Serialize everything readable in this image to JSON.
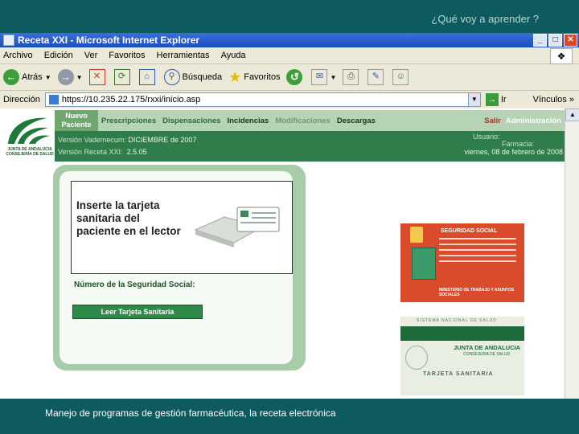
{
  "slide": {
    "title": "¿Qué voy a aprender ?",
    "footer": "Manejo de programas de gestión farmacéutica,  la receta electrónica"
  },
  "window": {
    "title": "Receta XXI - Microsoft Internet Explorer",
    "buttons": {
      "minimize": "_",
      "maximize": "□",
      "close": "✕"
    }
  },
  "menu": [
    "Archivo",
    "Edición",
    "Ver",
    "Favoritos",
    "Herramientas",
    "Ayuda"
  ],
  "toolbar": {
    "back": "Atrás",
    "search": "Búsqueda",
    "favorites": "Favoritos"
  },
  "address": {
    "label": "Dirección",
    "url": "https://10.235.22.175/rxxi/inicio.asp",
    "go": "Ir",
    "links": "Vínculos"
  },
  "app": {
    "logo_text": "JUNTA DE ANDALUCIA\nCONSEJERÍA DE SALUD",
    "nav": {
      "nuevo_paciente": "Nuevo Paciente",
      "prescripciones": "Prescripciones",
      "dispensaciones": "Dispensaciones",
      "incidencias": "Incidencias",
      "modificaciones": "Modificaciones",
      "descargas": "Descargas",
      "salir": "Salir",
      "administracion": "Administración"
    },
    "info": {
      "vademecum_label": "Versión Vademecum:",
      "vademecum_value": "DICIEMBRE de 2007",
      "receta_label": "Versión Receta XXI:",
      "receta_value": "2.5.05",
      "usuario_label": "Usuario:",
      "farmacia_label": "Farmacia:",
      "date": "viernes, 08 de febrero de 2008"
    },
    "panel": {
      "instruction": "Inserte la tarjeta sanitaria del paciente en el lector",
      "nss_label": "Número de la Seguridad Social:",
      "read_button": "Leer Tarjeta Sanitaria"
    },
    "ss_card": {
      "header": "SEGURIDAD SOCIAL",
      "ministry": "MINISTERIO DE TRABAJO Y ASUNTOS SOCIALES"
    },
    "ts_card": {
      "top": "SISTEMA NACIONAL DE SALUD",
      "org": "JUNTA DE ANDALUCIA",
      "dept": "CONSEJERIA DE SALUD",
      "name": "TARJETA SANITARIA"
    }
  }
}
